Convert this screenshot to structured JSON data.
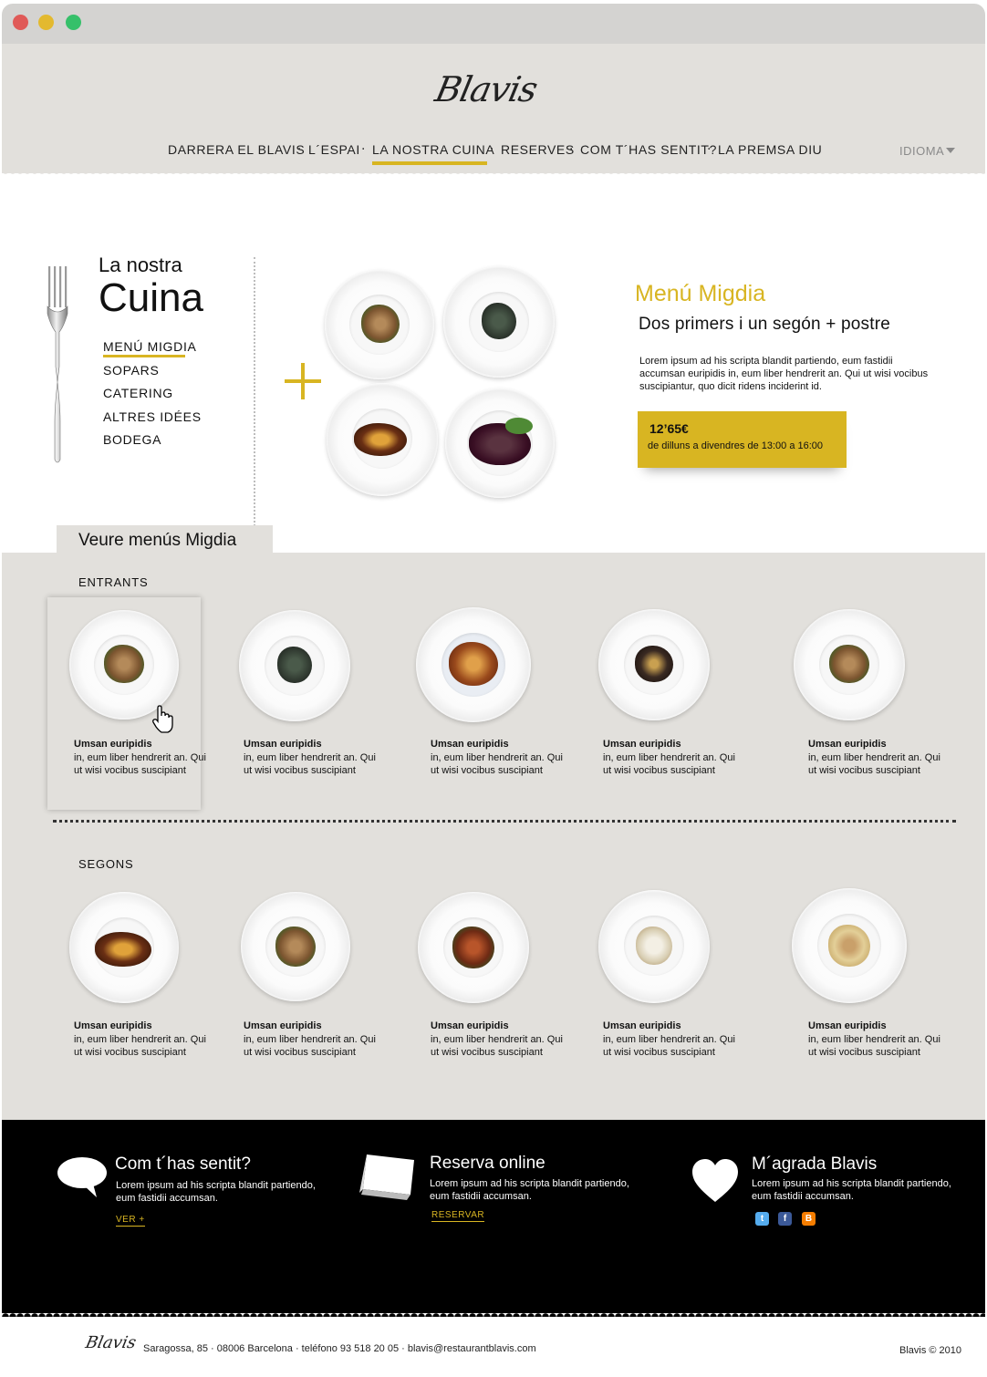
{
  "header": {
    "logo_text": "Blavis",
    "nav": [
      "DARRERA EL BLAVIS",
      "L´ESPAI",
      "LA NOSTRA CUINA",
      "RESERVES",
      "COM T´HAS SENTIT?",
      "LA PREMSA DIU"
    ],
    "nav_separator": "·",
    "active_nav": "LA NOSTRA CUINA",
    "language_label": "IDIOMA"
  },
  "section": {
    "title_small": "La nostra",
    "title_big": "Cuina",
    "side_menu": [
      "MENÚ MIGDIA",
      "SOPARS",
      "CATERING",
      "ALTRES IDÉES",
      "BODEGA"
    ],
    "active_side": "MENÚ MIGDIA"
  },
  "menu": {
    "title": "Menú Migdia",
    "subtitle": "Dos  primers i un segón + postre",
    "description": "Lorem ipsum ad his scripta blandit partiendo, eum fastidii accumsan euripidis in, eum liber hendrerit an. Qui ut wisi vocibus suscipiantur, quo dicit ridens inciderint id.",
    "price": "12’65€",
    "hours": "de dilluns a divendres de 13:00 a 16:00"
  },
  "tab": {
    "label": "Veure menús Migdia"
  },
  "entrants": {
    "label": "ENTRANTS",
    "items": [
      {
        "name": "Umsan euripidis",
        "desc": "in, eum liber hendrerit an. Qui ut wisi vocibus suscipiant"
      },
      {
        "name": "Umsan euripidis",
        "desc": "in, eum liber hendrerit an. Qui ut wisi vocibus suscipiant"
      },
      {
        "name": "Umsan euripidis",
        "desc": "in, eum liber hendrerit an. Qui ut wisi vocibus suscipiant"
      },
      {
        "name": "Umsan euripidis",
        "desc": "in, eum liber hendrerit an. Qui ut wisi vocibus suscipiant"
      },
      {
        "name": "Umsan euripidis",
        "desc": "in, eum liber hendrerit an. Qui ut wisi vocibus suscipiant"
      }
    ]
  },
  "segons": {
    "label": "SEGONS",
    "items": [
      {
        "name": "Umsan euripidis",
        "desc": "in, eum liber hendrerit an. Qui ut wisi vocibus suscipiant"
      },
      {
        "name": "Umsan euripidis",
        "desc": "in, eum liber hendrerit an. Qui ut wisi vocibus suscipiant"
      },
      {
        "name": "Umsan euripidis",
        "desc": "in, eum liber hendrerit an. Qui ut wisi vocibus suscipiant"
      },
      {
        "name": "Umsan euripidis",
        "desc": "in, eum liber hendrerit an. Qui ut wisi vocibus suscipiant"
      },
      {
        "name": "Umsan euripidis",
        "desc": "in, eum liber hendrerit an. Qui ut wisi vocibus suscipiant"
      }
    ]
  },
  "footer": {
    "feedback": {
      "title": "Com t´has sentit?",
      "text": "Lorem ipsum ad his scripta blandit partiendo, eum fastidii accumsan.",
      "link": "VER +",
      "icon": "speech-bubble-icon"
    },
    "reserve": {
      "title": "Reserva online",
      "text": "Lorem ipsum ad his scripta blandit partiendo, eum fastidii accumsan.",
      "link": "RESERVAR",
      "icon": "table-card-icon"
    },
    "like": {
      "title": "M´agrada Blavis",
      "text": "Lorem ipsum ad his scripta blandit partiendo, eum fastidii accumsan.",
      "icon": "heart-icon"
    },
    "social": [
      {
        "icon": "twitter-icon",
        "glyph": "t",
        "color": "#55acee"
      },
      {
        "icon": "facebook-icon",
        "glyph": "f",
        "color": "#3b5998"
      },
      {
        "icon": "blogger-icon",
        "glyph": "B",
        "color": "#f57d00"
      }
    ]
  },
  "bottom": {
    "logo_text": "Blavis",
    "address": "Saragossa, 85 · 08006 Barcelona · teléfono 93 518 20 05 · blavis@restaurantblavis.com",
    "copyright": "Blavis © 2010"
  },
  "colors": {
    "accent": "#d8b522",
    "panel": "#e2e0dc",
    "footer": "#000000"
  }
}
